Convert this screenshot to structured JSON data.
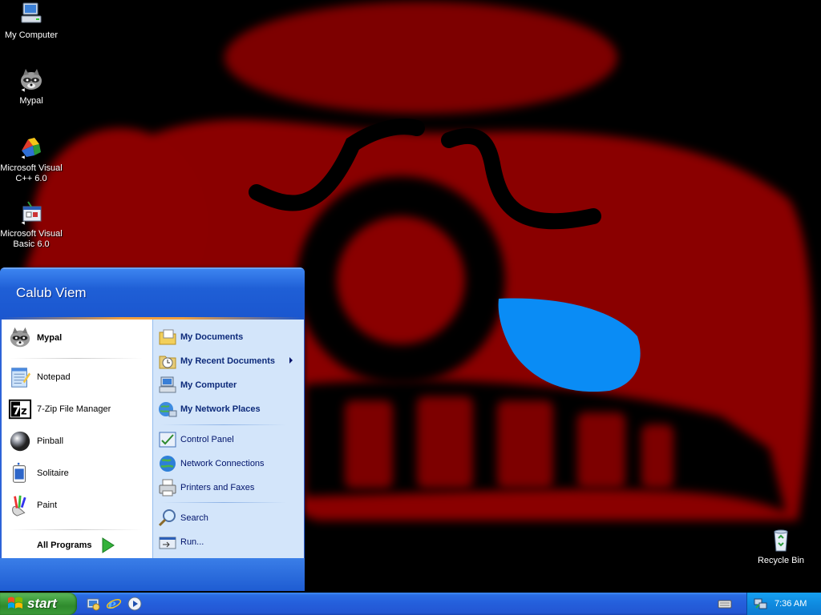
{
  "desktop": {
    "icons": [
      {
        "label": "My Computer",
        "icon": "my-computer-icon"
      },
      {
        "label": "Mypal",
        "icon": "raccoon-icon"
      },
      {
        "label": "Microsoft Visual C++ 6.0",
        "icon": "visual-cpp-icon"
      },
      {
        "label": "Microsoft Visual Basic 6.0",
        "icon": "visual-basic-icon"
      },
      {
        "label": "Recycle Bin",
        "icon": "recycle-bin-icon"
      }
    ]
  },
  "start_menu": {
    "user_name": "Calub Viem",
    "left_items": [
      {
        "label": "Mypal",
        "icon": "raccoon-icon",
        "pinned": true
      },
      {
        "label": "Notepad",
        "icon": "notepad-icon"
      },
      {
        "label": "7-Zip File Manager",
        "icon": "7zip-icon"
      },
      {
        "label": "Pinball",
        "icon": "pinball-icon"
      },
      {
        "label": "Solitaire",
        "icon": "solitaire-icon"
      },
      {
        "label": "Paint",
        "icon": "paint-icon"
      }
    ],
    "all_programs_label": "All Programs",
    "right_items": [
      {
        "label": "My Documents",
        "icon": "my-documents-icon"
      },
      {
        "label": "My Recent Documents",
        "icon": "recent-documents-icon"
      },
      {
        "label": "My Computer",
        "icon": "my-computer-icon"
      },
      {
        "label": "My Network Places",
        "icon": "network-places-icon"
      },
      {
        "label": "Control Panel",
        "icon": "control-panel-icon"
      },
      {
        "label": "Network Connections",
        "icon": "network-connections-icon"
      },
      {
        "label": "Printers and Faxes",
        "icon": "printers-icon"
      },
      {
        "label": "Search",
        "icon": "search-icon"
      },
      {
        "label": "Run...",
        "icon": "run-icon"
      }
    ]
  },
  "taskbar": {
    "start_label": "start",
    "quick_launch": [
      "show-desktop-icon",
      "internet-explorer-icon",
      "media-player-icon"
    ],
    "tray_icons": [
      "keyboard-icon",
      "network-tray-icon"
    ],
    "clock": "7:36 AM"
  },
  "colors": {
    "wallpaper_red": "#7a0000",
    "wallpaper_blue": "#0a8cf5",
    "taskbar_blue": "#245edb",
    "start_green": "#3c9a3a"
  }
}
